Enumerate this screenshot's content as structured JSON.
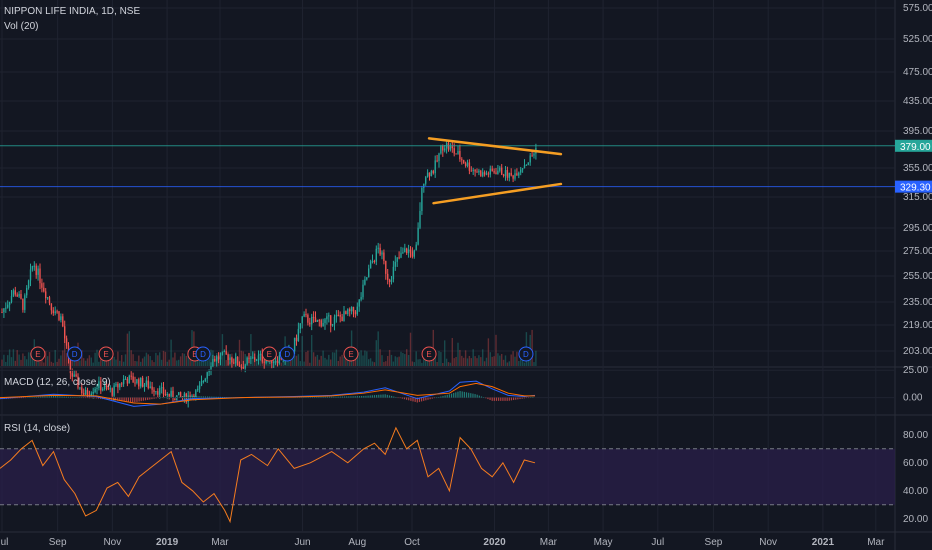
{
  "header": {
    "symbol": "NIPPON LIFE INDIA, 1D, NSE",
    "volume_label": "Vol (20)"
  },
  "macd_label": "MACD (12, 26, close, 9)",
  "rsi_label": "RSI (14, close)",
  "colors": {
    "background": "#131722",
    "up": "#26a69a",
    "down": "#ef5350",
    "trendline": "#f59e23",
    "macd": "#2962ff",
    "signal": "#ff6d00",
    "rsi": "#f57c1f",
    "rsi_band": "#2a1f4a",
    "earnings": "#ef5350",
    "dividend": "#2962ff"
  },
  "price_labels": {
    "current": "379.00",
    "support": "329.30"
  },
  "chart_data": [
    {
      "type": "candlestick",
      "title": "NIPPON LIFE INDIA, 1D, NSE",
      "x_ticks": [
        "Jul",
        "Sep",
        "Nov",
        "2019",
        "Mar",
        "Jun",
        "Aug",
        "Oct",
        "2020",
        "Mar",
        "May",
        "Jul",
        "Sep",
        "Nov",
        "2021",
        "Mar"
      ],
      "y_ticks": [
        "575.00",
        "525.00",
        "475.00",
        "435.00",
        "395.00",
        "355.00",
        "315.00",
        "295.00",
        "275.00",
        "255.00",
        "235.00",
        "219.00",
        "203.00"
      ],
      "y_tick_values": [
        575,
        525,
        475,
        435,
        395,
        355,
        315,
        295,
        275,
        255,
        235,
        219,
        203
      ],
      "price_path": [
        {
          "date": "2018-07-01",
          "price": 228
        },
        {
          "date": "2018-07-15",
          "price": 244
        },
        {
          "date": "2018-07-25",
          "price": 232
        },
        {
          "date": "2018-08-05",
          "price": 266
        },
        {
          "date": "2018-08-15",
          "price": 248
        },
        {
          "date": "2018-08-25",
          "price": 232
        },
        {
          "date": "2018-09-05",
          "price": 224
        },
        {
          "date": "2018-09-15",
          "price": 190
        },
        {
          "date": "2018-10-01",
          "price": 176
        },
        {
          "date": "2018-10-15",
          "price": 182
        },
        {
          "date": "2018-11-01",
          "price": 178
        },
        {
          "date": "2018-11-15",
          "price": 186
        },
        {
          "date": "2018-12-01",
          "price": 184
        },
        {
          "date": "2018-12-15",
          "price": 181
        },
        {
          "date": "2019-01-01",
          "price": 176
        },
        {
          "date": "2019-01-20",
          "price": 174
        },
        {
          "date": "2019-02-05",
          "price": 178
        },
        {
          "date": "2019-02-20",
          "price": 198
        },
        {
          "date": "2019-03-10",
          "price": 200
        },
        {
          "date": "2019-03-25",
          "price": 194
        },
        {
          "date": "2019-04-10",
          "price": 199
        },
        {
          "date": "2019-05-01",
          "price": 198
        },
        {
          "date": "2019-05-20",
          "price": 202
        },
        {
          "date": "2019-06-01",
          "price": 224
        },
        {
          "date": "2019-06-15",
          "price": 221
        },
        {
          "date": "2019-07-01",
          "price": 222
        },
        {
          "date": "2019-07-20",
          "price": 226
        },
        {
          "date": "2019-08-01",
          "price": 230
        },
        {
          "date": "2019-08-15",
          "price": 262
        },
        {
          "date": "2019-08-25",
          "price": 278
        },
        {
          "date": "2019-09-05",
          "price": 252
        },
        {
          "date": "2019-09-15",
          "price": 268
        },
        {
          "date": "2019-09-25",
          "price": 276
        },
        {
          "date": "2019-10-05",
          "price": 272
        },
        {
          "date": "2019-10-15",
          "price": 345
        },
        {
          "date": "2019-10-25",
          "price": 352
        },
        {
          "date": "2019-11-05",
          "price": 382
        },
        {
          "date": "2019-11-20",
          "price": 370
        },
        {
          "date": "2019-12-05",
          "price": 355
        },
        {
          "date": "2019-12-20",
          "price": 346
        },
        {
          "date": "2020-01-05",
          "price": 352
        },
        {
          "date": "2020-01-20",
          "price": 343
        },
        {
          "date": "2020-02-01",
          "price": 358
        },
        {
          "date": "2020-02-10",
          "price": 365
        },
        {
          "date": "2020-02-18",
          "price": 379
        }
      ],
      "horizontal_lines": [
        379.0,
        329.3
      ],
      "trendlines": [
        {
          "from": {
            "date": "2019-10-20",
            "price": 387
          },
          "to": {
            "date": "2020-03-15",
            "price": 370
          }
        },
        {
          "from": {
            "date": "2019-10-25",
            "price": 311
          },
          "to": {
            "date": "2020-03-15",
            "price": 333
          }
        }
      ],
      "event_markers": [
        {
          "date": "2018-08-10",
          "kind": "E"
        },
        {
          "date": "2018-09-20",
          "kind": "D"
        },
        {
          "date": "2018-10-25",
          "kind": "E"
        },
        {
          "date": "2019-02-01",
          "kind": "E"
        },
        {
          "date": "2019-02-10",
          "kind": "D"
        },
        {
          "date": "2019-04-25",
          "kind": "E"
        },
        {
          "date": "2019-05-15",
          "kind": "D"
        },
        {
          "date": "2019-07-25",
          "kind": "E"
        },
        {
          "date": "2019-10-20",
          "kind": "E"
        },
        {
          "date": "2020-02-05",
          "kind": "D"
        }
      ]
    },
    {
      "type": "line",
      "title": "MACD (12, 26, close, 9)",
      "y_ticks": [
        "25.00",
        "0.00"
      ],
      "y_tick_values": [
        25,
        0
      ],
      "ylim": [
        -15,
        27
      ],
      "series": [
        {
          "values": [
            [
              0,
              -1
            ],
            [
              0.1,
              3
            ],
            [
              0.18,
              1
            ],
            [
              0.25,
              -8
            ],
            [
              0.3,
              -6
            ],
            [
              0.36,
              -1
            ],
            [
              0.45,
              0
            ],
            [
              0.55,
              1
            ],
            [
              0.62,
              2
            ],
            [
              0.68,
              5
            ],
            [
              0.72,
              9
            ],
            [
              0.78,
              -1
            ],
            [
              0.84,
              6
            ],
            [
              0.86,
              14
            ],
            [
              0.89,
              15
            ],
            [
              0.92,
              8
            ],
            [
              0.95,
              2
            ],
            [
              0.98,
              1
            ],
            [
              1.0,
              2
            ]
          ]
        },
        {
          "values": [
            [
              0,
              0
            ],
            [
              0.1,
              2
            ],
            [
              0.18,
              1.5
            ],
            [
              0.25,
              -5
            ],
            [
              0.3,
              -6
            ],
            [
              0.36,
              -2
            ],
            [
              0.45,
              0
            ],
            [
              0.55,
              0.5
            ],
            [
              0.62,
              1.5
            ],
            [
              0.68,
              4
            ],
            [
              0.72,
              7
            ],
            [
              0.78,
              2
            ],
            [
              0.84,
              4
            ],
            [
              0.86,
              10
            ],
            [
              0.89,
              13
            ],
            [
              0.92,
              10
            ],
            [
              0.95,
              4
            ],
            [
              0.98,
              1.5
            ],
            [
              1.0,
              1.5
            ]
          ]
        }
      ]
    },
    {
      "type": "line",
      "title": "RSI (14, close)",
      "y_ticks": [
        "80.00",
        "60.00",
        "40.00",
        "20.00"
      ],
      "y_tick_values": [
        80,
        60,
        40,
        20
      ],
      "ylim": [
        12,
        92
      ],
      "band": [
        30,
        70
      ],
      "series": [
        {
          "values": [
            [
              0,
              56
            ],
            [
              0.02,
              62
            ],
            [
              0.04,
              70
            ],
            [
              0.06,
              76
            ],
            [
              0.08,
              58
            ],
            [
              0.1,
              68
            ],
            [
              0.12,
              48
            ],
            [
              0.14,
              38
            ],
            [
              0.16,
              22
            ],
            [
              0.18,
              26
            ],
            [
              0.2,
              42
            ],
            [
              0.22,
              46
            ],
            [
              0.24,
              36
            ],
            [
              0.26,
              50
            ],
            [
              0.28,
              56
            ],
            [
              0.3,
              62
            ],
            [
              0.32,
              68
            ],
            [
              0.34,
              46
            ],
            [
              0.36,
              40
            ],
            [
              0.38,
              32
            ],
            [
              0.4,
              38
            ],
            [
              0.42,
              26
            ],
            [
              0.43,
              18
            ],
            [
              0.45,
              62
            ],
            [
              0.47,
              66
            ],
            [
              0.5,
              58
            ],
            [
              0.52,
              70
            ],
            [
              0.55,
              56
            ],
            [
              0.58,
              60
            ],
            [
              0.62,
              68
            ],
            [
              0.65,
              60
            ],
            [
              0.68,
              70
            ],
            [
              0.7,
              74
            ],
            [
              0.72,
              66
            ],
            [
              0.74,
              85
            ],
            [
              0.76,
              70
            ],
            [
              0.78,
              76
            ],
            [
              0.8,
              50
            ],
            [
              0.82,
              56
            ],
            [
              0.84,
              40
            ],
            [
              0.86,
              78
            ],
            [
              0.88,
              70
            ],
            [
              0.9,
              56
            ],
            [
              0.92,
              50
            ],
            [
              0.94,
              60
            ],
            [
              0.96,
              46
            ],
            [
              0.98,
              62
            ],
            [
              1.0,
              60
            ]
          ]
        }
      ]
    }
  ]
}
